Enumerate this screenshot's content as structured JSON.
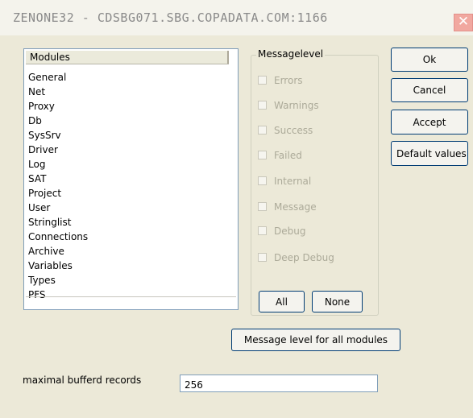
{
  "window": {
    "title": "ZENONE32 - CDSBG071.SBG.COPADATA.COM:1166",
    "close_glyph": "✕"
  },
  "modules_list": {
    "header": "Modules",
    "items": [
      "General",
      "Net",
      "Proxy",
      "Db",
      "SysSrv",
      "Driver",
      "Log",
      "SAT",
      "Project",
      "User",
      "Stringlist",
      "Connections",
      "Archive",
      "Variables",
      "Types",
      "PFS"
    ]
  },
  "message_level": {
    "title": "Messagelevel",
    "checkboxes": [
      {
        "label": "Errors",
        "checked": false,
        "enabled": false
      },
      {
        "label": "Warnings",
        "checked": false,
        "enabled": false
      },
      {
        "label": "Success",
        "checked": false,
        "enabled": false
      },
      {
        "label": "Failed",
        "checked": false,
        "enabled": false
      },
      {
        "label": "Internal",
        "checked": false,
        "enabled": false
      },
      {
        "label": "Message",
        "checked": false,
        "enabled": false
      },
      {
        "label": "Debug",
        "checked": false,
        "enabled": false
      },
      {
        "label": "Deep Debug",
        "checked": false,
        "enabled": false
      }
    ],
    "all_label": "All",
    "none_label": "None",
    "all_modules_label": "Message level for all modules"
  },
  "buttons": {
    "ok": "Ok",
    "cancel": "Cancel",
    "accept": "Accept",
    "default_values": "Default values"
  },
  "records": {
    "label": "maximal bufferd records",
    "value": "256"
  },
  "colors": {
    "dialog_bg": "#ece9d8",
    "disabled_text": "#acaa99",
    "button_border": "#003c74",
    "input_border": "#7f9db9"
  }
}
